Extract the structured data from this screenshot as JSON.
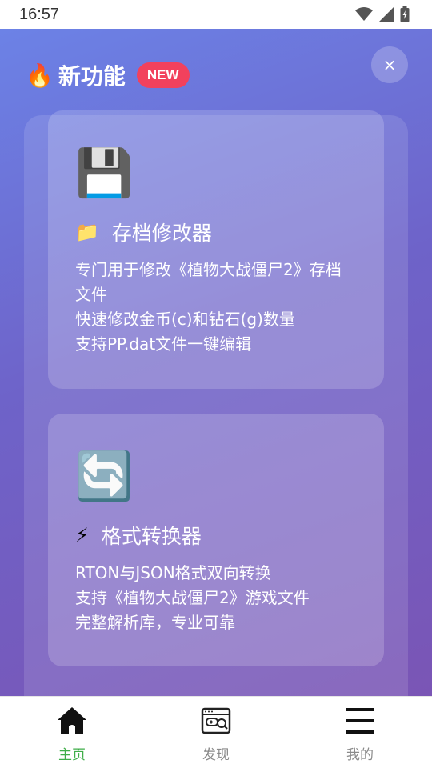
{
  "status_bar": {
    "time": "16:57"
  },
  "header": {
    "title": "新功能",
    "badge": "NEW",
    "fire_icon": "🔥",
    "close_label": "×"
  },
  "cards": [
    {
      "big_icon": "💾",
      "title_icon": "📁",
      "title": "存档修改器",
      "desc_lines": [
        "专门用于修改《植物大战僵尸2》存档",
        "文件",
        "快速修改金币(c)和钻石(g)数量",
        "支持PP.dat文件一键编辑"
      ]
    },
    {
      "big_icon": "🔄",
      "title_icon": "⚡",
      "title": "格式转换器",
      "desc_lines": [
        "RTON与JSON格式双向转换",
        "支持《植物大战僵尸2》游戏文件",
        "完整解析库，专业可靠"
      ]
    }
  ],
  "nav": {
    "items": [
      {
        "label": "主页",
        "icon": "home-icon"
      },
      {
        "label": "发现",
        "icon": "discover-icon"
      },
      {
        "label": "我的",
        "icon": "menu-icon"
      }
    ],
    "active_color": "#3fae49",
    "inactive_color": "#8a8a8a"
  }
}
